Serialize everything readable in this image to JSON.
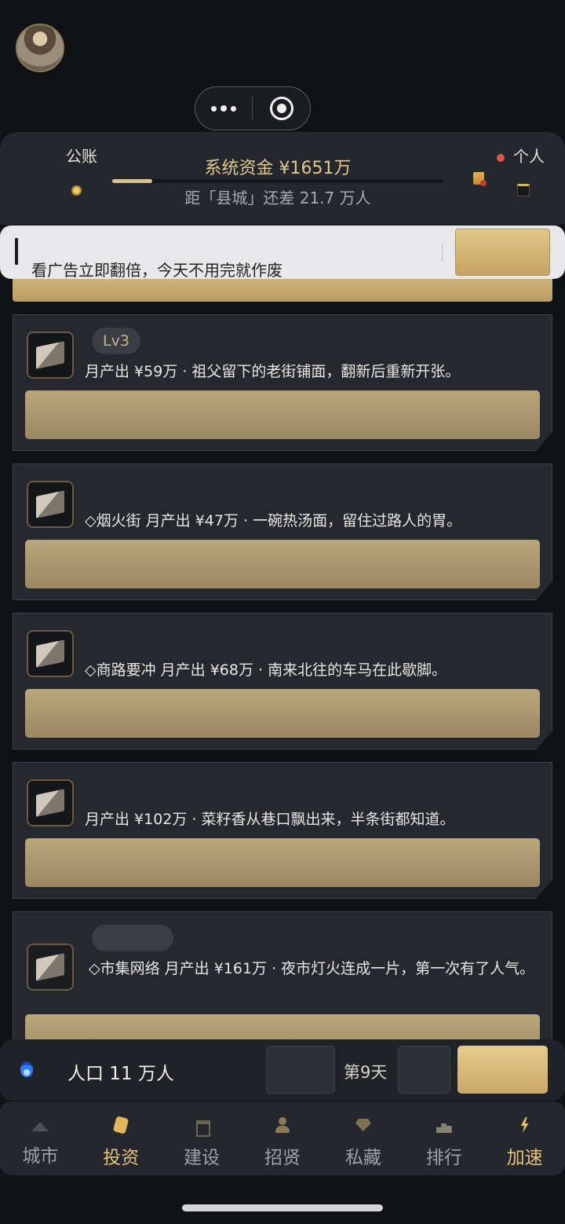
{
  "header": {
    "public_label": "公账",
    "funds_label": "系统资金 ¥1651万",
    "progress": 0.12,
    "gap_text": "距「县城」还差 21.7 万人",
    "personal_label": "个人"
  },
  "toast": {
    "message": "看广告立即翻倍，今天不用完就作废"
  },
  "cards": [
    {
      "level": "Lv3",
      "desc": "月产出 ¥59万 · 祖父留下的老街铺面，翻新后重新开张。"
    },
    {
      "level": "",
      "desc": "◇烟火街 月产出 ¥47万 · 一碗热汤面，留住过路人的胃。"
    },
    {
      "level": "",
      "desc": "◇商路要冲 月产出 ¥68万 · 南来北往的车马在此歇脚。"
    },
    {
      "level": "",
      "desc": "月产出 ¥102万 · 菜籽香从巷口飘出来，半条街都知道。"
    },
    {
      "level": "",
      "desc": "◇市集网络 月产出 ¥161万 · 夜市灯火连成一片，第一次有了人气。"
    }
  ],
  "status_bar": {
    "population": "人口 11 万人",
    "day": "第9天"
  },
  "tabs": [
    {
      "label": "城市",
      "icon": "mountain-icon"
    },
    {
      "label": "投资",
      "icon": "money-icon"
    },
    {
      "label": "建设",
      "icon": "building-icon"
    },
    {
      "label": "招贤",
      "icon": "person-icon"
    },
    {
      "label": "私藏",
      "icon": "gem-icon"
    },
    {
      "label": "排行",
      "icon": "rank-icon"
    },
    {
      "label": "加速",
      "icon": "bolt-icon"
    }
  ],
  "colors": {
    "accent_gold": "#e4c98c",
    "background": "#101216",
    "card": "#25282f"
  }
}
